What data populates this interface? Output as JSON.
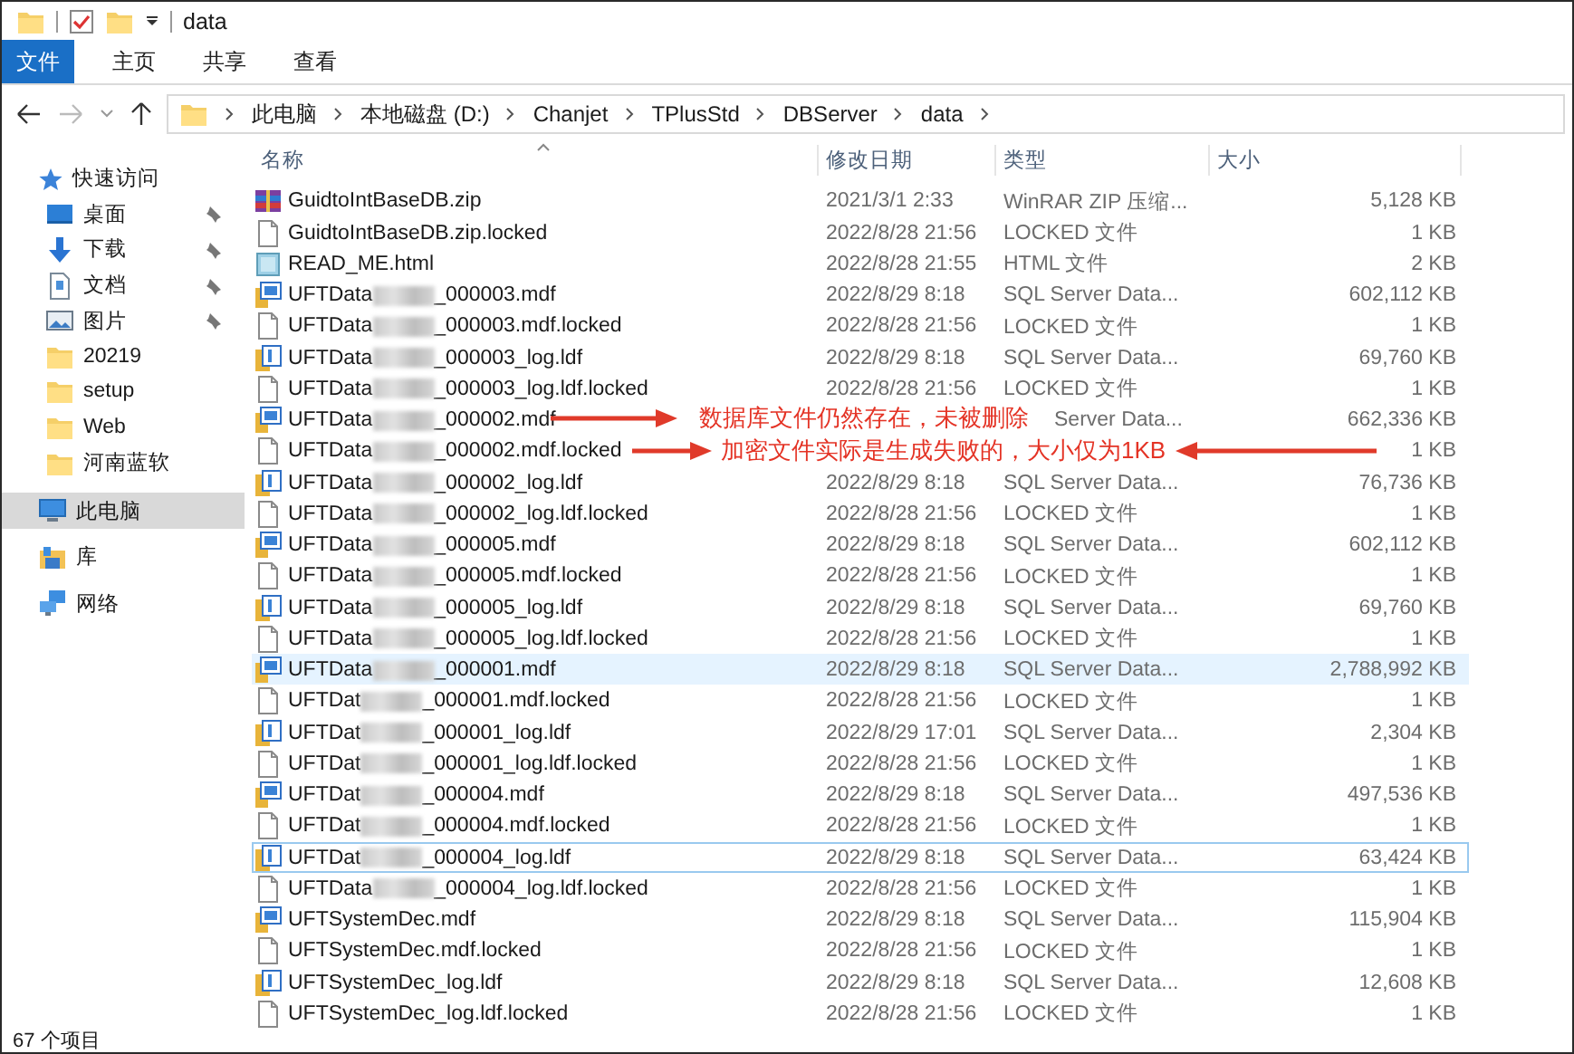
{
  "window": {
    "title": "data"
  },
  "ribbon_tabs": [
    {
      "label": "文件",
      "kind": "file"
    },
    {
      "label": "主页",
      "kind": "tab"
    },
    {
      "label": "共享",
      "kind": "tab"
    },
    {
      "label": "查看",
      "kind": "tab"
    }
  ],
  "address": {
    "crumbs": [
      "此电脑",
      "本地磁盘 (D:)",
      "Chanjet",
      "TPlusStd",
      "DBServer",
      "data"
    ]
  },
  "sidebar": {
    "items": [
      {
        "label": "快速访问",
        "kind": "star",
        "selected": false,
        "children": [
          {
            "label": "桌面",
            "kind": "desktop",
            "pinned": true,
            "selected": false
          },
          {
            "label": "下载",
            "kind": "download",
            "pinned": true,
            "selected": false
          },
          {
            "label": "文档",
            "kind": "document",
            "pinned": true,
            "selected": false
          },
          {
            "label": "图片",
            "kind": "pictures",
            "pinned": true,
            "selected": false
          },
          {
            "label": "20219",
            "kind": "folder",
            "pinned": false,
            "selected": false
          },
          {
            "label": "setup",
            "kind": "folder",
            "pinned": false,
            "selected": false
          },
          {
            "label": "Web",
            "kind": "folder",
            "pinned": false,
            "selected": false
          },
          {
            "label": "河南蓝软",
            "kind": "folder",
            "pinned": false,
            "selected": false
          }
        ]
      },
      {
        "label": "此电脑",
        "kind": "pc",
        "selected": true
      },
      {
        "label": "库",
        "kind": "library",
        "selected": false
      },
      {
        "label": "网络",
        "kind": "network",
        "selected": false
      }
    ]
  },
  "file_list": {
    "columns": [
      {
        "label": "名称",
        "sorted": true
      },
      {
        "label": "修改日期",
        "sorted": false
      },
      {
        "label": "类型",
        "sorted": false
      },
      {
        "label": "大小",
        "sorted": false
      }
    ],
    "rows": [
      {
        "kind": "zip",
        "name": "GuidtoIntBaseDB.zip",
        "date": "2021/3/1 2:33",
        "type": "WinRAR ZIP 压缩...",
        "size": "5,128 KB",
        "hovered": false,
        "focused": false
      },
      {
        "kind": "locked",
        "name": "GuidtoIntBaseDB.zip.locked",
        "date": "2022/8/28 21:56",
        "type": "LOCKED 文件",
        "size": "1 KB",
        "hovered": false,
        "focused": false
      },
      {
        "kind": "html",
        "name": "READ_ME.html",
        "date": "2022/8/28 21:55",
        "type": "HTML 文件",
        "size": "2 KB",
        "hovered": false,
        "focused": false
      },
      {
        "kind": "mdf",
        "name": "UFTData",
        "name_end": "_000003.mdf",
        "date": "2022/8/29 8:18",
        "type": "SQL Server Data...",
        "size": "602,112 KB",
        "hovered": false,
        "focused": false
      },
      {
        "kind": "locked",
        "name": "UFTData",
        "name_end": "_000003.mdf.locked",
        "date": "2022/8/28 21:56",
        "type": "LOCKED 文件",
        "size": "1 KB",
        "hovered": false,
        "focused": false
      },
      {
        "kind": "ldf",
        "name": "UFTData",
        "name_end": "_000003_log.ldf",
        "date": "2022/8/29 8:18",
        "type": "SQL Server Data...",
        "size": "69,760 KB",
        "hovered": false,
        "focused": false
      },
      {
        "kind": "locked",
        "name": "UFTData",
        "name_end": "_000003_log.ldf.locked",
        "date": "2022/8/28 21:56",
        "type": "LOCKED 文件",
        "size": "1 KB",
        "hovered": false,
        "focused": false
      },
      {
        "kind": "mdf",
        "name": "UFTData",
        "name_end": "_000002.mdf",
        "type": "Server Data...",
        "type_clipped": true,
        "size": "662,336 KB",
        "hovered": false,
        "focused": false
      },
      {
        "kind": "locked",
        "name": "UFTData",
        "name_end": "_000002.mdf.locked",
        "size": "1 KB",
        "hovered": false,
        "focused": false
      },
      {
        "kind": "ldf",
        "name": "UFTData",
        "name_end": "_000002_log.ldf",
        "date": "2022/8/29 8:18",
        "type": "SQL Server Data...",
        "size": "76,736 KB",
        "hovered": false,
        "focused": false
      },
      {
        "kind": "locked",
        "name": "UFTData",
        "name_end": "_000002_log.ldf.locked",
        "date": "2022/8/28 21:56",
        "type": "LOCKED 文件",
        "size": "1 KB",
        "hovered": false,
        "focused": false
      },
      {
        "kind": "mdf",
        "name": "UFTData",
        "name_end": "_000005.mdf",
        "date": "2022/8/29 8:18",
        "type": "SQL Server Data...",
        "size": "602,112 KB",
        "hovered": false,
        "focused": false
      },
      {
        "kind": "locked",
        "name": "UFTData",
        "name_end": "_000005.mdf.locked",
        "date": "2022/8/28 21:56",
        "type": "LOCKED 文件",
        "size": "1 KB",
        "hovered": false,
        "focused": false
      },
      {
        "kind": "ldf",
        "name": "UFTData",
        "name_end": "_000005_log.ldf",
        "date": "2022/8/29 8:18",
        "type": "SQL Server Data...",
        "size": "69,760 KB",
        "hovered": false,
        "focused": false
      },
      {
        "kind": "locked",
        "name": "UFTData",
        "name_end": "_000005_log.ldf.locked",
        "date": "2022/8/28 21:56",
        "type": "LOCKED 文件",
        "size": "1 KB",
        "hovered": false,
        "focused": false
      },
      {
        "kind": "mdf",
        "name": "UFTData",
        "name_end": "_000001.mdf",
        "date": "2022/8/29 8:18",
        "type": "SQL Server Data...",
        "size": "2,788,992 KB",
        "hovered": true,
        "focused": false
      },
      {
        "kind": "locked",
        "name": "UFTDat",
        "name_end": "_000001.mdf.locked",
        "date": "2022/8/28 21:56",
        "type": "LOCKED 文件",
        "size": "1 KB",
        "hovered": false,
        "focused": false
      },
      {
        "kind": "ldf",
        "name": "UFTDat",
        "name_end": "_000001_log.ldf",
        "date": "2022/8/29 17:01",
        "type": "SQL Server Data...",
        "size": "2,304 KB",
        "hovered": false,
        "focused": false
      },
      {
        "kind": "locked",
        "name": "UFTDat",
        "name_end": "_000001_log.ldf.locked",
        "date": "2022/8/28 21:56",
        "type": "LOCKED 文件",
        "size": "1 KB",
        "hovered": false,
        "focused": false
      },
      {
        "kind": "mdf",
        "name": "UFTDat",
        "name_end": "_000004.mdf",
        "date": "2022/8/29 8:18",
        "type": "SQL Server Data...",
        "size": "497,536 KB",
        "hovered": false,
        "focused": false
      },
      {
        "kind": "locked",
        "name": "UFTDat",
        "name_end": "_000004.mdf.locked",
        "date": "2022/8/28 21:56",
        "type": "LOCKED 文件",
        "size": "1 KB",
        "hovered": false,
        "focused": false
      },
      {
        "kind": "ldf",
        "name": "UFTDat",
        "name_end": "_000004_log.ldf",
        "date": "2022/8/29 8:18",
        "type": "SQL Server Data...",
        "size": "63,424 KB",
        "hovered": false,
        "focused": true
      },
      {
        "kind": "locked",
        "name": "UFTData",
        "name_end": "_000004_log.ldf.locked",
        "date": "2022/8/28 21:56",
        "type": "LOCKED 文件",
        "size": "1 KB",
        "hovered": false,
        "focused": false
      },
      {
        "kind": "mdf",
        "name": "UFTSystemDec.mdf",
        "date": "2022/8/29 8:18",
        "type": "SQL Server Data...",
        "size": "115,904 KB",
        "hovered": false,
        "focused": false
      },
      {
        "kind": "locked",
        "name": "UFTSystemDec.mdf.locked",
        "date": "2022/8/28 21:56",
        "type": "LOCKED 文件",
        "size": "1 KB",
        "hovered": false,
        "focused": false
      },
      {
        "kind": "ldf",
        "name": "UFTSystemDec_log.ldf",
        "date": "2022/8/29 8:18",
        "type": "SQL Server Data...",
        "size": "12,608 KB",
        "hovered": false,
        "focused": false
      },
      {
        "kind": "locked",
        "name": "UFTSystemDec_log.ldf.locked",
        "date": "2022/8/28 21:56",
        "type": "LOCKED 文件",
        "size": "1 KB",
        "hovered": false,
        "focused": false
      }
    ]
  },
  "annotations": [
    {
      "text": "数据库文件仍然存在，未被删除",
      "kind": "arrow-left"
    },
    {
      "text": "加密文件实际是生成失败的，大小仅为1KB",
      "kind": "arrows-both"
    }
  ],
  "status_bar": {
    "count": "67 个项目"
  }
}
